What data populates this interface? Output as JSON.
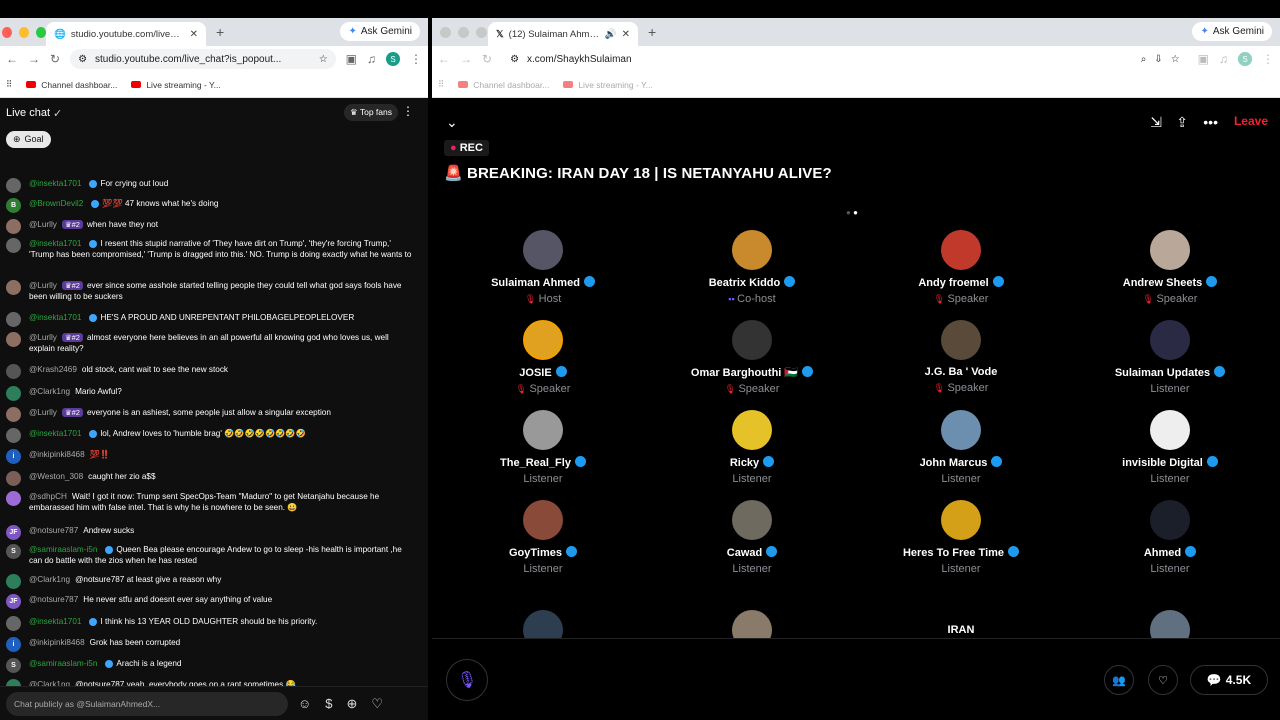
{
  "left_window": {
    "tab_title": "studio.youtube.com/live_chat",
    "ask_gemini": "Ask Gemini",
    "url": "studio.youtube.com/live_chat?is_popout...",
    "bookmarks": [
      "Channel dashboar...",
      "Live streaming - Y..."
    ],
    "profile_initial": "S"
  },
  "chat": {
    "title": "Live chat",
    "top_fans": "Top fans",
    "goal": "Goal",
    "input_placeholder": "Chat publicly as @SulaimanAhmedX...",
    "messages": [
      {
        "author": "@insekta1701",
        "text": "For crying out loud",
        "av": "",
        "color": "#666",
        "green": true,
        "badge": ""
      },
      {
        "author": "@BrownDevil2",
        "text": "💯💯 47 knows what he's doing",
        "av": "B",
        "color": "#2e7d32",
        "green": true,
        "badge": ""
      },
      {
        "author": "@Lurlly",
        "text": "when have they not",
        "av": "",
        "color": "#8d6e63",
        "green": false,
        "badge": "#2"
      },
      {
        "author": "@insekta1701",
        "text": "I resent this stupid narrative of 'They have dirt on Trump', 'they're forcing Trump,' 'Trump has been compromised,' 'Trump is dragged into this.' NO. Trump is doing exactly what he wants to",
        "av": "",
        "color": "#666",
        "green": true,
        "badge": ""
      },
      {
        "author": "@Lurlly",
        "text": "ever since some asshole started telling people they could tell what god says fools have been willing to be suckers",
        "av": "",
        "color": "#8d6e63",
        "green": false,
        "badge": "#2"
      },
      {
        "author": "@insekta1701",
        "text": "HE'S A PROUD AND UNREPENTANT PHILOBAGELPEOPLELOVER",
        "av": "",
        "color": "#666",
        "green": true,
        "badge": ""
      },
      {
        "author": "@Lurlly",
        "text": "almost everyone here believes in an all powerful all knowing god who loves us, well explain reality?",
        "av": "",
        "color": "#8d6e63",
        "green": false,
        "badge": "#2"
      },
      {
        "author": "@Krash2469",
        "text": "old stock, cant wait to see the new stock",
        "av": "",
        "color": "#555",
        "green": false,
        "badge": ""
      },
      {
        "author": "@Clark1ng",
        "text": "Mario Awful?",
        "av": "",
        "color": "#2e7d5b",
        "green": false,
        "badge": ""
      },
      {
        "author": "@Lurlly",
        "text": "everyone is an ashiest, some people just allow a singular exception",
        "av": "",
        "color": "#8d6e63",
        "green": false,
        "badge": "#2"
      },
      {
        "author": "@insekta1701",
        "text": "lol, Andrew loves to 'humble brag' 🤣🤣🤣🤣🤣🤣🤣🤣",
        "av": "",
        "color": "#666",
        "green": true,
        "badge": ""
      },
      {
        "author": "@inkipinki8468",
        "text": "💯‼️",
        "av": "i",
        "color": "#1e5fbf",
        "green": false,
        "badge": ""
      },
      {
        "author": "@Weston_308",
        "text": "caught her zio a$$",
        "av": "",
        "color": "#7b5e57",
        "green": false,
        "badge": ""
      },
      {
        "author": "@sdhpCH",
        "text": "Wait! I got it now: Trump sent SpecOps-Team \"Maduro\" to get Netanjahu because he embarassed him with false intel. That is why he is nowhere to be seen. 😀",
        "av": "",
        "color": "#9c6bd8",
        "green": false,
        "badge": ""
      },
      {
        "author": "@notsure787",
        "text": "Andrew sucks",
        "av": "JF",
        "color": "#7e57c2",
        "green": false,
        "badge": ""
      },
      {
        "author": "@samiraaslam-i5n",
        "text": "Queen Bea please encourage Andew to go to sleep -his health is important ,he can do battle with the zios when he has rested",
        "av": "S",
        "color": "#555",
        "green": true,
        "badge": ""
      },
      {
        "author": "@Clark1ng",
        "text": "@notsure787 at least give a reason why",
        "av": "",
        "color": "#2e7d5b",
        "green": false,
        "badge": ""
      },
      {
        "author": "@notsure787",
        "text": "He never stfu and doesnt ever say anything of value",
        "av": "JF",
        "color": "#7e57c2",
        "green": false,
        "badge": ""
      },
      {
        "author": "@insekta1701",
        "text": "I think his 13 YEAR OLD DAUGHTER should be his priority.",
        "av": "",
        "color": "#666",
        "green": true,
        "badge": ""
      },
      {
        "author": "@inkipinki8468",
        "text": "Grok has been corrupted",
        "av": "i",
        "color": "#1e5fbf",
        "green": false,
        "badge": ""
      },
      {
        "author": "@samiraaslam-i5n",
        "text": "Arachi is a legend",
        "av": "S",
        "color": "#555",
        "green": true,
        "badge": ""
      },
      {
        "author": "@Clark1ng",
        "text": "@notsure787 yeah, everybody goes on a rant sometimes 😂",
        "av": "",
        "color": "#2e7d5b",
        "green": false,
        "badge": ""
      }
    ]
  },
  "right_window": {
    "tab_title": "(12) Sulaiman Ahmed (@S",
    "ask_gemini": "Ask Gemini",
    "url": "x.com/ShaykhSulaiman",
    "bookmarks": [
      "Channel dashboar...",
      "Live streaming - Y..."
    ],
    "profile_initial": "S"
  },
  "space": {
    "rec": "REC",
    "title": "🚨 BREAKING: IRAN DAY 18 | IS NETANYAHU ALIVE?",
    "leave": "Leave",
    "count": "4.5K",
    "people": [
      {
        "name": "Sulaiman Ahmed",
        "role": "Host",
        "verified": true,
        "pic": "#556"
      },
      {
        "name": "Beatrix Kiddo",
        "role": "Co-host",
        "verified": true,
        "pic": "#c98a2e"
      },
      {
        "name": "Andy froemel",
        "role": "Speaker",
        "verified": true,
        "pic": "#c0392b"
      },
      {
        "name": "Andrew Sheets",
        "role": "Speaker",
        "verified": true,
        "pic": "#b9a89a"
      },
      {
        "name": "JOSIE",
        "role": "Speaker",
        "verified": true,
        "pic": "#e0a020"
      },
      {
        "name": "Omar Barghouthi 🇵🇸",
        "role": "Speaker",
        "verified": true,
        "pic": "#333"
      },
      {
        "name": "J.G. Ba ' Vode",
        "role": "Speaker",
        "verified": false,
        "pic": "#5a4a3a"
      },
      {
        "name": "Sulaiman Updates",
        "role": "Listener",
        "verified": true,
        "pic": "#2a2a44"
      },
      {
        "name": "The_Real_Fly",
        "role": "Listener",
        "verified": true,
        "pic": "#999"
      },
      {
        "name": "Ricky",
        "role": "Listener",
        "verified": true,
        "pic": "#e6c229"
      },
      {
        "name": "John Marcus",
        "role": "Listener",
        "verified": true,
        "pic": "#6c8fb0"
      },
      {
        "name": "invisible Digital",
        "role": "Listener",
        "verified": true,
        "pic": "#eee"
      },
      {
        "name": "GoyTimes",
        "role": "Listener",
        "verified": true,
        "pic": "#8a4a3a"
      },
      {
        "name": "Cawad",
        "role": "Listener",
        "verified": true,
        "pic": "#6e6a60"
      },
      {
        "name": "Heres To Free Time",
        "role": "Listener",
        "verified": true,
        "pic": "#d4a017"
      },
      {
        "name": "Ahmed",
        "role": "Listener",
        "verified": true,
        "pic": "#1a1f2a"
      }
    ],
    "partial_row_label": "IRAN"
  }
}
